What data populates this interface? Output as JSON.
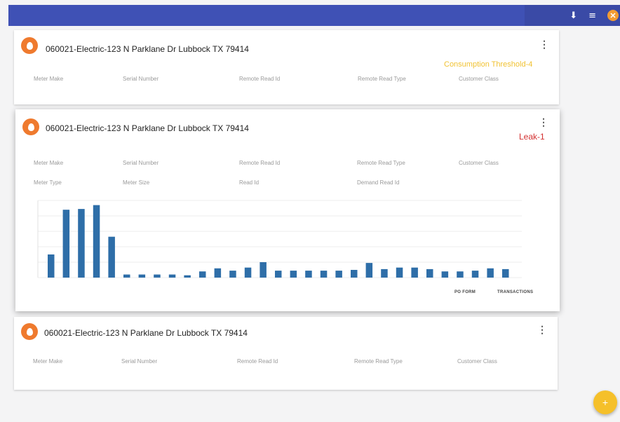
{
  "header": {
    "download_icon": "⬇",
    "list_icon": "≡",
    "close_icon": "✕"
  },
  "fields_row1": {
    "meter_make": "Meter Make",
    "serial_number": "Serial Number",
    "remote_read_id": "Remote Read Id",
    "remote_read_type": "Remote Read Type",
    "customer_class": "Customer Class"
  },
  "fields_row2": {
    "meter_type": "Meter Type",
    "meter_size": "Meter Size",
    "read_id": "Read Id",
    "demand_read_id": "Demand Read Id"
  },
  "cards": [
    {
      "title": "060021-Electric-123 N Parklane Dr Lubbock TX 79414",
      "status": "Consumption Threshold-4"
    },
    {
      "title": "060021-Electric-123 N Parklane Dr Lubbock TX 79414",
      "status": "Leak-1"
    },
    {
      "title": "060021-Electric-123 N Parklane Dr Lubbock TX 79414",
      "status": ""
    }
  ],
  "actions": {
    "po_form": "PO FORM",
    "transactions": "TRANSACTIONS"
  },
  "fab": {
    "label": "+"
  },
  "colors": {
    "header": "#3f51b5",
    "bar": "#2e6ea8",
    "threshold": "#f1c232",
    "leak": "#d32f2f",
    "avatar": "#ef7a2e",
    "fab": "#f5c02a"
  },
  "chart_data": {
    "type": "bar",
    "values": [
      30,
      88,
      89,
      94,
      53,
      4,
      4,
      4,
      4,
      3,
      8,
      12,
      9,
      13,
      20,
      9,
      9,
      9,
      9,
      9,
      10,
      19,
      11,
      13,
      13,
      11,
      8,
      8,
      9,
      12,
      11
    ],
    "ylim": [
      0,
      100
    ],
    "grid": true,
    "bar_color": "#2e6ea8"
  }
}
